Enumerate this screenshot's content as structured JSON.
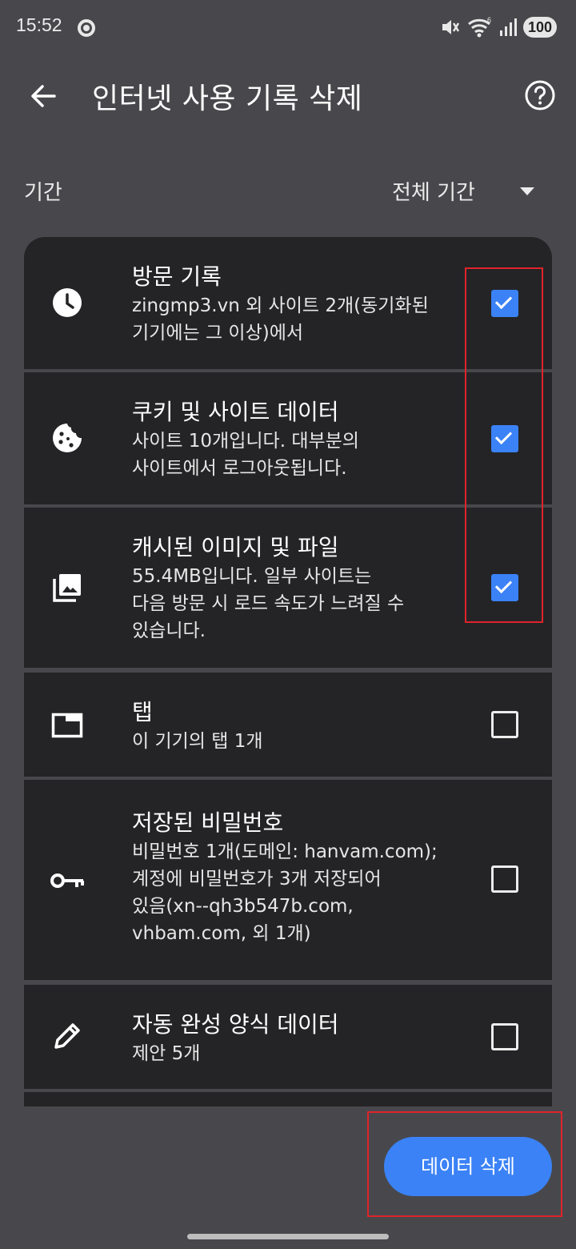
{
  "status_bar": {
    "time": "15:52",
    "battery": "100",
    "icons": [
      "chrome-icon",
      "mute-icon",
      "wifi-icon",
      "signal-icon"
    ]
  },
  "app_bar": {
    "title": "인터넷 사용 기록 삭제",
    "back_icon": "arrow-left-icon",
    "help_icon": "help-circle-icon"
  },
  "period": {
    "label": "기간",
    "selected": "전체 기간"
  },
  "items": [
    {
      "icon": "clock-icon",
      "title": "방문 기록",
      "description": "zingmp3.vn 외 사이트 2개(동기화된\n기기에는 그 이상)에서",
      "checked": true
    },
    {
      "icon": "cookie-icon",
      "title": "쿠키 및 사이트 데이터",
      "description": "사이트 10개입니다. 대부분의\n사이트에서 로그아웃됩니다.",
      "checked": true
    },
    {
      "icon": "image-stack-icon",
      "title": "캐시된 이미지 및 파일",
      "description": "55.4MB입니다. 일부 사이트는\n다음 방문 시 로드 속도가 느려질 수\n있습니다.",
      "checked": true
    },
    {
      "icon": "tab-icon",
      "title": "탭",
      "description": "이 기기의 탭 1개",
      "checked": false
    },
    {
      "icon": "key-icon",
      "title": "저장된 비밀번호",
      "description": "비밀번호 1개(도메인: hanvam.com);\n계정에 비밀번호가 3개 저장되어\n있음(xn--qh3b547b.com,\nvhbam.com, 외 1개)",
      "checked": false
    },
    {
      "icon": "pencil-icon",
      "title": "자동 완성 양식 데이터",
      "description": "제안 5개",
      "checked": false
    }
  ],
  "footer": {
    "delete_label": "데이터 삭제"
  },
  "colors": {
    "background": "#48484c",
    "card": "#242426",
    "accent": "#3b82f6",
    "annotation": "#e0232b"
  }
}
